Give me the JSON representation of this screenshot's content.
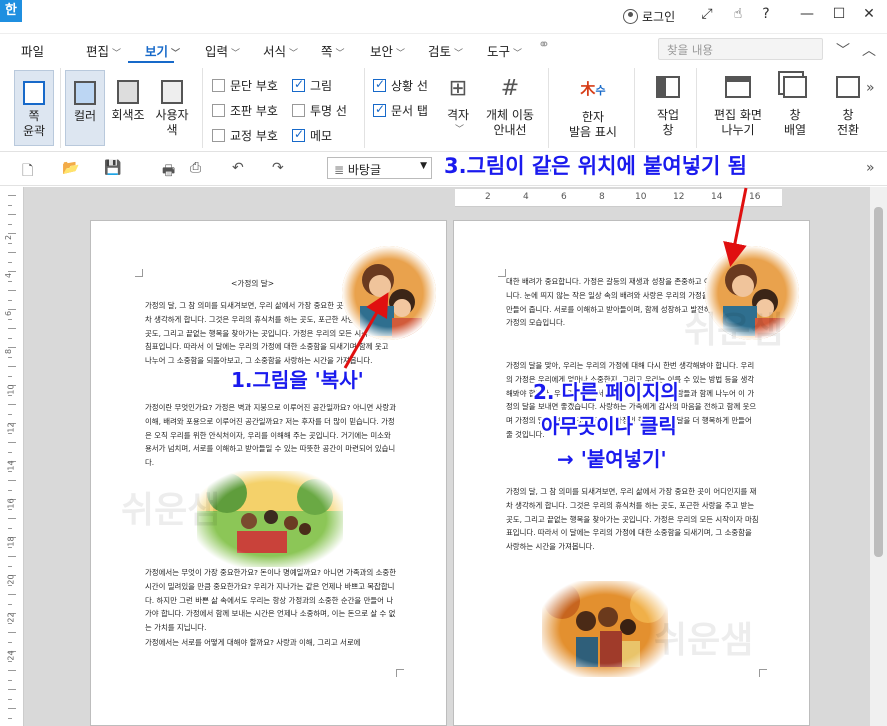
{
  "titlebar": {
    "app_icon": "한",
    "login_label": "로그인",
    "icons": [
      "user-circle-icon",
      "expand-icon",
      "hand-icon",
      "help-icon",
      "minimize-icon",
      "maximize-icon",
      "close-icon"
    ],
    "help": "?"
  },
  "menu": {
    "items": [
      {
        "label": "파일"
      },
      {
        "label": "편집"
      },
      {
        "label": "보기"
      },
      {
        "label": "입력"
      },
      {
        "label": "서식"
      },
      {
        "label": "쪽"
      },
      {
        "label": "보안"
      },
      {
        "label": "검토"
      },
      {
        "label": "도구"
      }
    ],
    "active": "보기",
    "search_placeholder": "찾을 내용",
    "accent": "#1769c9"
  },
  "ribbon": {
    "page_outline": "쪽\n윤곽",
    "color": "컬러",
    "grayscale": "회색조",
    "user_color": "사용자\n색",
    "checks": [
      {
        "label": "문단 부호",
        "checked": false
      },
      {
        "label": "그림",
        "checked": true
      },
      {
        "label": "조판 부호",
        "checked": false
      },
      {
        "label": "투명 선",
        "checked": false
      },
      {
        "label": "교정 부호",
        "checked": false
      },
      {
        "label": "메모",
        "checked": true
      },
      {
        "label": "상황 선",
        "checked": true
      },
      {
        "label": "문서 탭",
        "checked": true
      }
    ],
    "grid": "격자",
    "object_move_guide": "개체 이동\n안내선",
    "hanja_reading": "한자\n발음 표시",
    "work_window": "작업\n창",
    "edit_screen_split": "편집 화면\n나누기",
    "window_arrange": "창\n배열",
    "window_switch": "창\n전환"
  },
  "toolbar2": {
    "style_value": "바탕글"
  },
  "ruler": {
    "h_numbers": [
      "2",
      "4",
      "6",
      "8",
      "10",
      "12",
      "14",
      "16"
    ],
    "v_numbers": [
      "2",
      "4",
      "6",
      "8",
      "10",
      "12",
      "14",
      "16",
      "18",
      "20",
      "22",
      "24"
    ]
  },
  "page1": {
    "title": "<가정의 달>",
    "para1": "가정의 달, 그 참 의미를 되새겨보면, 우리 삶에서 가장 중요한 곳이 어디인지를 재차 생각하게 합니다. 그것은 우리의 휴식처를 하는 곳도, 포근한 사랑을 주고 받는 곳도, 그리고 끝없는 행복을 찾아가는 곳입니다. 가정은 우리의 모든 시작이자 마침표입니다. 따라서 이 달에는 우리의 가정에 대한 소중함을 되새기며 함께 웃고 나누어 그 소중함을 되돌아보고, 그 소중함을 사랑하는 시간을 가져봅니다.",
    "para2": "가정이란 무엇인가요? 가정은 벽과 지붕으로 이루어진 공간일까요? 아니면 사랑과 이해, 배려와 포용으로 이루어진 공간일까요? 저는 후자를 더 많이 믿습니다. 가정은 오직 우리를 위한 안식처이자, 우리를 이해해 주는 곳입니다. 거기에는 미소와 용서가 넘치며, 서로를 이해하고 받아들일 수 있는 따뜻한 공간이 마련되어 있습니다.",
    "para3": "가정에서는 무엇이 가장 중요한가요? 돈이나 명예일까요? 아니면 가족과의 소중한 시간이 밀려있을 만큼 중요한가요? 우리가 지나가는 같은 언제나 바쁘고 복잡합니다. 하지만 그런 바쁜 삶 속에서도 우리는 항상 가정과의 소중한 순간을 만들어 나가야 합니다. 가정에서 함께 보내는 시간은 언제나 소중하며, 이는 돈으로 살 수 없는 가치를 지닙니다.",
    "para4": "가정에서는 서로를 어떻게 대해야 할까요? 사랑과 이해, 그리고 서로에"
  },
  "page2": {
    "para1": "대한 배려가 중요합니다. 가정은 갈등의 재생과 성장을 존중하고 이해해 주는 곳입니다. 눈에 띄지 않는 작은 일상 속의 배려와 사랑은 우리의 가정을 더욱 풍요롭게 만들어 줍니다. 서로를 이해하고 받아들이며, 함께 성장하고 발전하는 것이 진정한 가정의 모습입니다.",
    "para2": "가정의 달을 맞아, 우리는 우리의 가정에 대해 다시 한번 생각해봐야 합니다. 우리의 가정은 우리에게 얼마나 소중한지, 그리고 우리는 이를 수 있는 방법 등을 생각해봐야 합니다. 우리가 가정에서 더 행복하고, 소중한 사람들과 함께 나누어 이 가정의 달을 보내면 좋겠습니다. 사랑하는 가족에게 감사의 마음을 전하고 함께 웃으며 가정의 달을 보내는 것이 진정한 가정의 행복이며 이 달을 더 행복하게 만들어 줄 것입니다.",
    "para3": "가정의 달, 그 참 의미를 되새겨보면, 우리 삶에서 가장 중요한 곳이 어디인지를 재차 생각하게 합니다. 그것은 우리의 휴식처를 하는 곳도, 포근한 사랑을 주고 받는 곳도, 그리고 끝없는 행복을 찾아가는 곳입니다. 가정은 우리의 모든 시작이자 마침표입니다. 따라서 이 달에는 우리의 가정에 대한 소중함을 되새기며, 그 소중함을 사랑하는 시간을 가져봅니다."
  },
  "watermark": "쉬운샘",
  "annotations": {
    "step1": "1.그림을 '복사'",
    "step2_line1": "2. 다른 페이지의",
    "step2_line2": "아무곳이나 클릭",
    "step2_line3": "→ '붙여넣기'",
    "step3": "3.그림이 같은 위치에 붙여넣기 됨",
    "color": "#1a1aee",
    "arrow_color": "#e01010"
  }
}
